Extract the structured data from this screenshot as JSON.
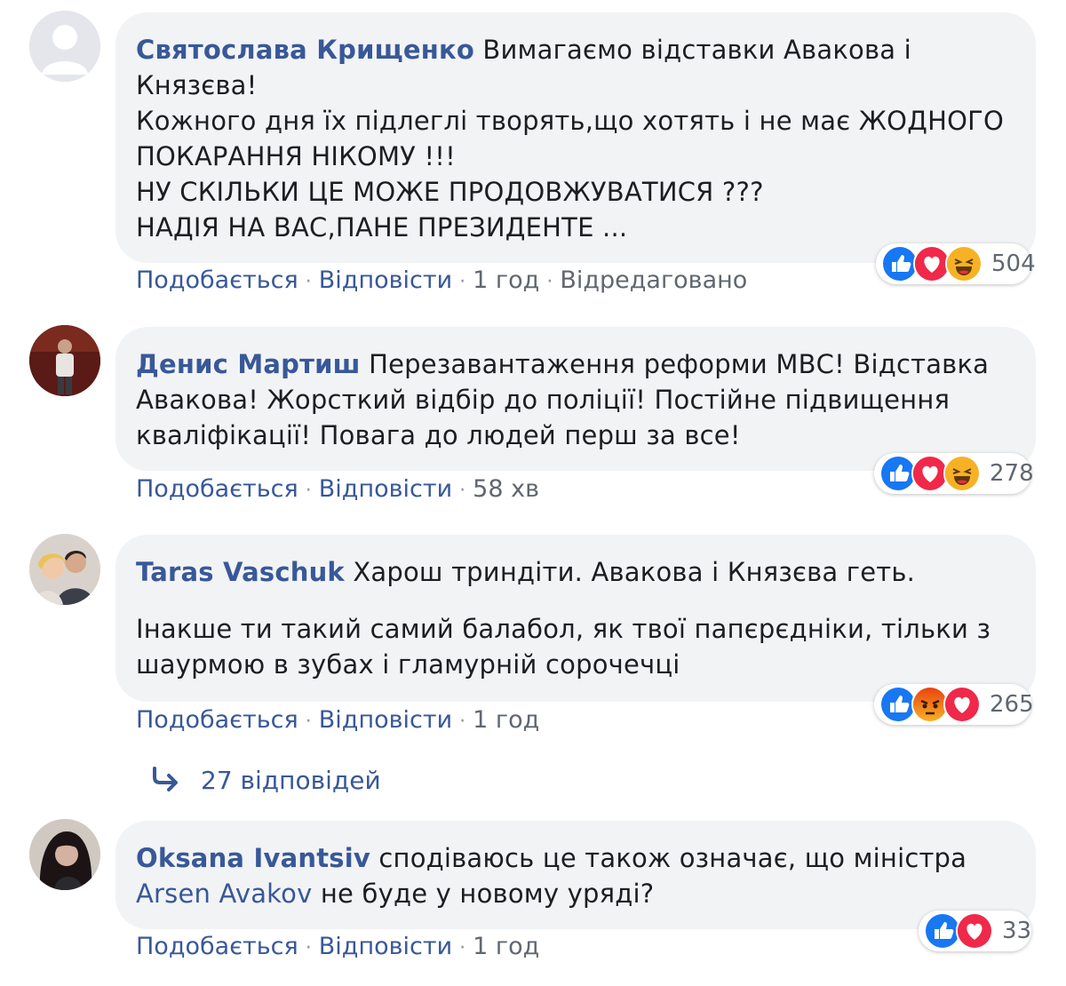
{
  "comments": [
    {
      "author": "Святослава Крищенко",
      "lines": [
        "Вимагаємо відставки Авакова і",
        "Князєва!",
        "Кожного дня їх підлеглі творять,що хотять і не має ЖОДНОГО",
        "ПОКАРАННЯ НІКОМУ !!!",
        "НУ СКІЛЬКИ ЦЕ МОЖЕ ПРОДОВЖУВАТИСЯ ???",
        "НАДІЯ НА ВАС,ПАНЕ ПРЕЗИДЕНТЕ ..."
      ],
      "like": "Подобається",
      "reply": "Відповісти",
      "time": "1 год",
      "edited": "Відредаговано",
      "reaction_icons": [
        "like-icon",
        "love-icon",
        "haha-icon"
      ],
      "reaction_count": "504"
    },
    {
      "author": "Денис Мартиш",
      "lines": [
        "Перезавантаження реформи МВС! Відставка",
        "Авакова! Жорсткий відбір до поліції! Постійне підвищення",
        "кваліфікації! Повага до людей перш за все!"
      ],
      "like": "Подобається",
      "reply": "Відповісти",
      "time": "58 хв",
      "reaction_icons": [
        "like-icon",
        "love-icon",
        "haha-icon"
      ],
      "reaction_count": "278"
    },
    {
      "author": "Taras Vaschuk",
      "lines": [
        "Харош триндіти. Авакова і Князєва геть.",
        "Інакше ти такий самий балабол, як твої папєрєдніки, тільки з",
        "шаурмою в зубах і гламурній сорочечці"
      ],
      "like": "Подобається",
      "reply": "Відповісти",
      "time": "1 год",
      "reaction_icons": [
        "like-icon",
        "angry-icon",
        "love-icon"
      ],
      "reaction_count": "265"
    },
    {
      "author": "Oksana Ivantsiv",
      "lines": [
        "сподіваюсь це також означає, що міністра",
        "не буде у новому уряді?"
      ],
      "mention": "Arsen Avakov",
      "like": "Подобається",
      "reply": "Відповісти",
      "time": "1 год",
      "reaction_icons": [
        "like-icon",
        "love-icon"
      ],
      "reaction_count": "33"
    }
  ],
  "replies_link": "27 відповідей",
  "colors": {
    "link": "#385898",
    "bubble": "#f2f3f5",
    "meta": "#606770",
    "like": "#1877f2",
    "love": "#f0284a",
    "haha": "#f7b125",
    "angry": "#e9710f"
  }
}
